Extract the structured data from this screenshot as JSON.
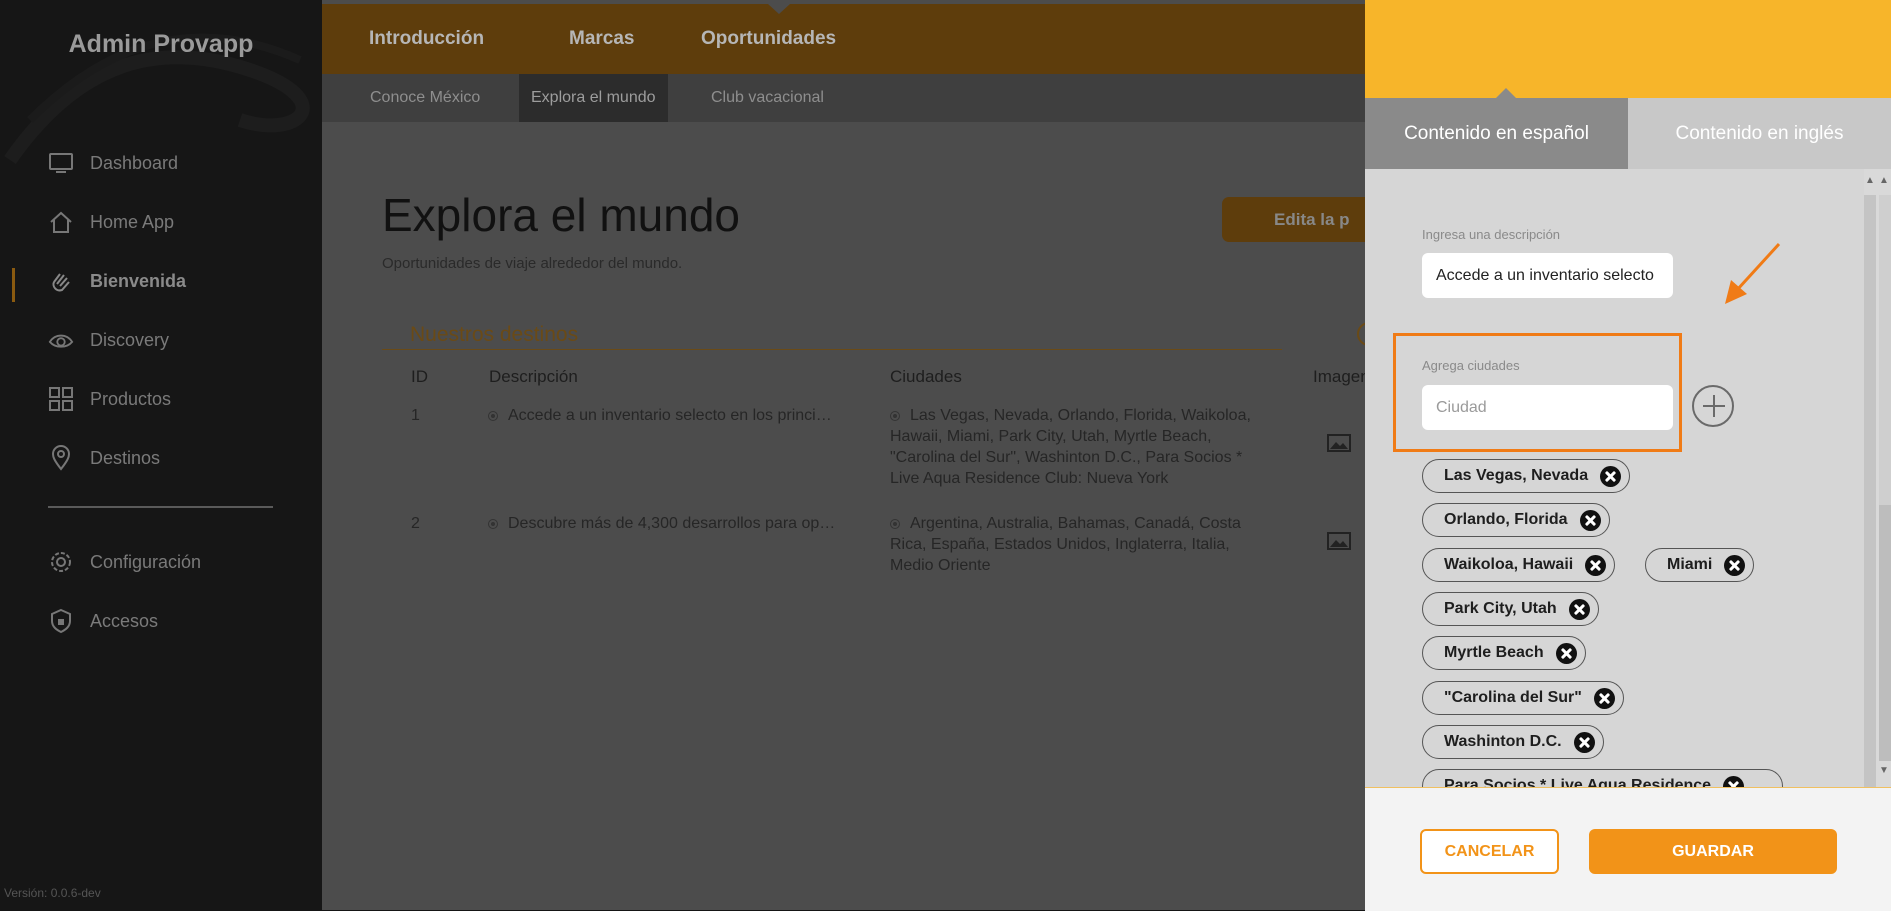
{
  "sidebar": {
    "brand": "Admin Provapp",
    "items": [
      {
        "label": "Dashboard",
        "icon": "monitor-icon"
      },
      {
        "label": "Home App",
        "icon": "home-icon"
      },
      {
        "label": "Bienvenida",
        "icon": "wave-hand-icon",
        "active": true
      },
      {
        "label": "Discovery",
        "icon": "eye-icon"
      },
      {
        "label": "Productos",
        "icon": "grid-icon"
      },
      {
        "label": "Destinos",
        "icon": "map-pin-icon"
      },
      {
        "label": "Configuración",
        "icon": "gear-icon"
      },
      {
        "label": "Accesos",
        "icon": "shield-icon"
      }
    ],
    "version": "Versión: 0.0.6-dev"
  },
  "topnav": {
    "tabs": [
      "Introducción",
      "Marcas",
      "Oportunidades"
    ],
    "active_tab": "Oportunidades"
  },
  "subnav": {
    "tabs": [
      "Conoce México",
      "Explora el mundo",
      "Club vacacional"
    ],
    "active_tab": "Explora el mundo"
  },
  "page": {
    "title": "Explora el mundo",
    "subtitle": "Oportunidades de viaje alrededor del mundo.",
    "edit_button": "Edita la p"
  },
  "section": {
    "title": "Nuestros destinos",
    "columns": [
      "ID",
      "Descripción",
      "Ciudades",
      "Imagen"
    ],
    "rows": [
      {
        "id": "1",
        "description": "Accede a un inventario selecto en los princi…",
        "cities": [
          "Las Vegas, Nevada, Orlando, Florida, Waikoloa,",
          "Hawaii, Miami, Park City, Utah, Myrtle Beach,",
          "\"Carolina del Sur\", Washinton D.C., Para Socios *",
          "Live Aqua Residence Club: Nueva York"
        ]
      },
      {
        "id": "2",
        "description": "Descubre más de 4,300 desarrollos para op…",
        "cities": [
          "Argentina, Australia, Bahamas, Canadá, Costa",
          "Rica, España, Estados Unidos, Inglaterra, Italia,",
          "Medio Oriente"
        ]
      }
    ]
  },
  "drawer": {
    "tabs": {
      "es": "Contenido en español",
      "en": "Contenido en inglés"
    },
    "active_tab": "es",
    "description": {
      "label": "Ingresa una descripción",
      "value": "Accede a un inventario selecto"
    },
    "cities": {
      "label": "Agrega ciudades",
      "placeholder": "Ciudad"
    },
    "chips": [
      "Las Vegas, Nevada",
      "Orlando, Florida",
      "Waikoloa, Hawaii",
      "Miami",
      "Park City, Utah",
      "Myrtle Beach",
      "\"Carolina del Sur\"",
      "Washinton D.C.",
      "Para Socios * Live Aqua Residence"
    ],
    "cancel_label": "CANCELAR",
    "save_label": "GUARDAR"
  },
  "colors": {
    "accent": "#f29318",
    "drawer_header": "#f7b52a",
    "highlight": "#f07b16"
  }
}
